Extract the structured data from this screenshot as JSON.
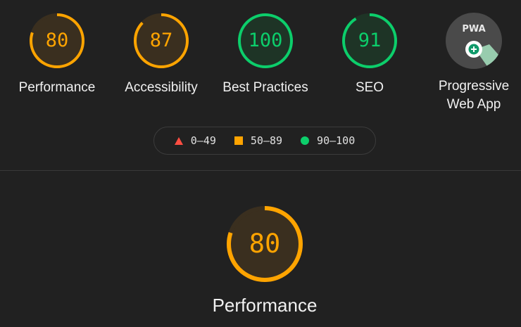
{
  "summary": {
    "categories": [
      {
        "label": "Performance",
        "score": 80,
        "color": "#ffa400",
        "fill": "#3a2f1f"
      },
      {
        "label": "Accessibility",
        "score": 87,
        "color": "#ffa400",
        "fill": "#3a2f1f"
      },
      {
        "label": "Best Practices",
        "score": 100,
        "color": "#0cce6b",
        "fill": "#1e3426"
      },
      {
        "label": "SEO",
        "score": 91,
        "color": "#0cce6b",
        "fill": "#1e3426"
      }
    ],
    "pwa": {
      "label_line1": "Progressive",
      "label_line2": "Web App",
      "badge_text": "PWA",
      "icon": "pwa-badge-icon"
    }
  },
  "legend": [
    {
      "label": "0–49",
      "shape": "triangle",
      "color": "#ff4e42"
    },
    {
      "label": "50–89",
      "shape": "square",
      "color": "#ffa400"
    },
    {
      "label": "90–100",
      "shape": "circle",
      "color": "#0cce6b"
    }
  ],
  "section": {
    "label": "Performance",
    "score": 80,
    "color": "#ffa400",
    "fill": "#3a2f1f"
  }
}
